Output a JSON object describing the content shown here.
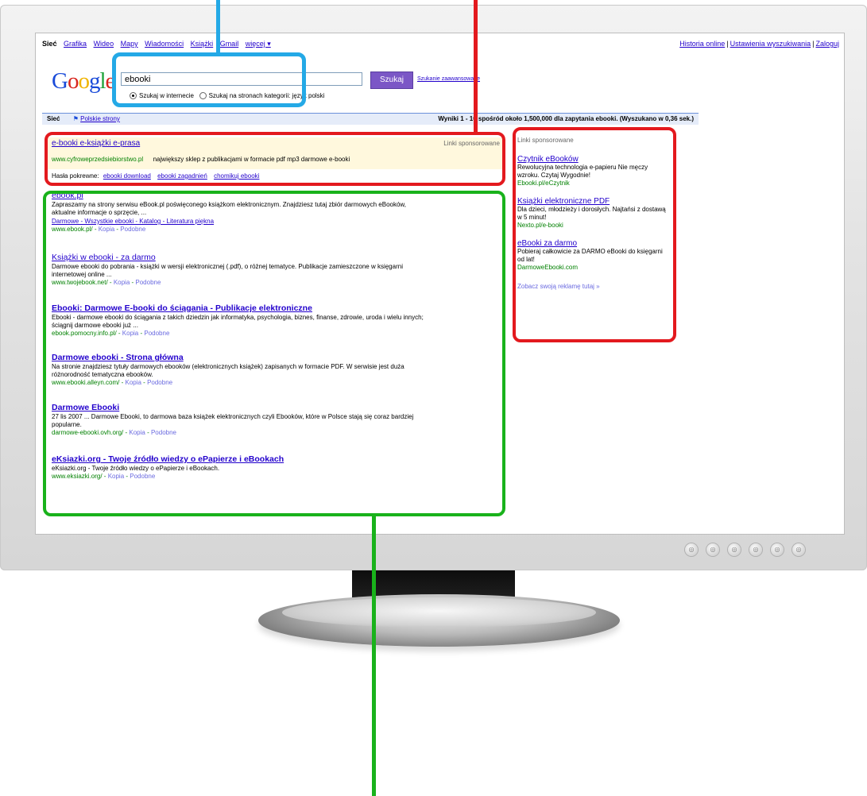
{
  "top_nav": {
    "items": [
      "Sieć",
      "Grafika",
      "Wideo",
      "Mapy",
      "Wiadomości",
      "Książki",
      "Gmail",
      "więcej ▾"
    ],
    "right": [
      "Historia online",
      "Ustawienia wyszukiwania",
      "Zaloguj"
    ]
  },
  "logo": {
    "text": "Google"
  },
  "search": {
    "query": "ebooki",
    "button": "Szukaj",
    "advanced": "Szukanie zaawansowane",
    "radio_web": "Szukaj w internecie",
    "radio_pages": "Szukaj na stronach",
    "radio_pages_suffix": "kategorii: język polski"
  },
  "info_bar": {
    "left_label": "Sieć",
    "safe_label": "Polskie strony",
    "right_text": "Wyniki 1 - 10 spośród około 1,500,000 dla zapytania ebooki. (Wyszukano w 0,36 sek.)"
  },
  "sponsored_top": {
    "label": "Linki sponsorowane",
    "title": "e-booki e-książki e-prasa",
    "url": "www.cyfroweprzedsiebiorstwo.pl",
    "text": "największy sklep z publikacjami w formacie pdf mp3 darmowe e-booki",
    "related_label": "Hasła pokrewne:",
    "related": [
      "ebooki download",
      "ebooki zagadnień",
      "chomikuj ebooki"
    ]
  },
  "results": [
    {
      "title": "ebook.pl",
      "snippet": "Zapraszamy na strony serwisu eBook.pl poświęconego książkom elektronicznym. Znajdziesz tutaj zbiór darmowych eBooków, aktualne informacje o sprzęcie, ...",
      "sitelinks": "Darmowe - Wszystkie ebooki - Katalog - Literatura piękna",
      "url": "www.ebook.pl/",
      "cache": "Kopia",
      "similar": "Podobne"
    },
    {
      "title": "Książki w ebooki - za darmo",
      "snippet": "Darmowe ebooki do pobrania - książki w wersji elektronicznej (.pdf), o różnej tematyce. Publikacje zamieszczone w księgarni internetowej online ...",
      "url": "www.twojebook.net/",
      "cache": "Kopia",
      "similar": "Podobne"
    },
    {
      "title": "Ebooki: Darmowe E-booki do ściągania - Publikacje elektroniczne",
      "snippet": "Ebooki - darmowe ebooki do ściągania z takich dziedzin jak informatyka, psychologia, biznes, finanse, zdrowie, uroda i wielu innych; ściągnij darmowe ebooki już ...",
      "url": "ebook.pomocny.info.pl/",
      "cache": "Kopia",
      "similar": "Podobne"
    },
    {
      "title": "Darmowe ebooki - Strona główna",
      "snippet": "Na stronie znajdziesz tytuły darmowych ebooków (elektronicznych książek) zapisanych w formacie PDF. W serwisie jest duża różnorodność tematyczna ebooków.",
      "url": "www.ebooki.alleyn.com/",
      "cache": "Kopia",
      "similar": "Podobne"
    },
    {
      "title": "Darmowe Ebooki",
      "snippet": "27 lis 2007 ... Darmowe Ebooki, to darmowa baza książek elektronicznych czyli Ebooków, które w Polsce stają się coraz bardziej popularne.",
      "url": "darmowe-ebooki.ovh.org/",
      "cache": "Kopia",
      "similar": "Podobne"
    },
    {
      "title": "eKsiazki.org - Twoje źródło wiedzy o ePapierze i eBookach",
      "snippet": "eKsiazki.org - Twoje źródło wiedzy o ePapierze i eBookach.",
      "url": "www.eksiazki.org/",
      "cache": "Kopia",
      "similar": "Podobne"
    }
  ],
  "right_ads": {
    "label": "Linki sponsorowane",
    "ads": [
      {
        "title": "Czytnik eBooków",
        "text": "Rewolucyjna technologia e-papieru Nie męczy wzroku. Czytaj Wygodnie!",
        "url": "Ebooki.pl/eCzytnik"
      },
      {
        "title": "Książki elektroniczne PDF",
        "text": "Dla dzieci, młodzieży i dorosłych. Najtańsi z dostawą w 5 minut!",
        "url": "Nexto.pl/e-booki"
      },
      {
        "title": "eBooki za darmo",
        "text": "Pobieraj całkowicie za DARMO eBooki do księgarni od lat!",
        "url": "DarmoweEbooki.com"
      }
    ],
    "more": "Zobacz swoją reklamę tutaj »"
  },
  "monitor_buttons": [
    "◎",
    "◎",
    "◎",
    "◎",
    "◎",
    "◎"
  ],
  "annotation_colors": {
    "search_box": "#24a9e6",
    "ads": "#e3191e",
    "organic": "#19b21b"
  }
}
